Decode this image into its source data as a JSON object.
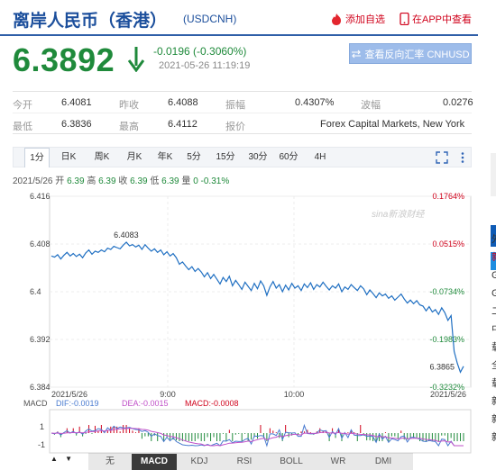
{
  "header": {
    "title": "离岸人民币（香港）",
    "code": "(USDCNH)",
    "add_watch": "添加自选",
    "view_app": "在APP中查看"
  },
  "quote": {
    "price": "6.3892",
    "change": "-0.0196 (-0.3060%)",
    "time": "2021-05-26 11:19:19",
    "reverse_label": "查看反向汇率 CNHUSD",
    "trend": "down",
    "trend_color": "#1f8a3b"
  },
  "stats": {
    "open_label": "今开",
    "open": "6.4081",
    "prev_close_label": "昨收",
    "prev_close": "6.4088",
    "amplitude_label": "振幅",
    "amplitude": "0.4307%",
    "volatility_label": "波幅",
    "volatility": "0.0276",
    "low_label": "最低",
    "low": "6.3836",
    "high_label": "最高",
    "high": "6.4112",
    "quote_label": "报价",
    "quote_source": "Forex Capital Markets, New York"
  },
  "period_tabs": [
    "1分",
    "日K",
    "周K",
    "月K",
    "年K",
    "5分",
    "15分",
    "30分",
    "60分",
    "4H"
  ],
  "active_period": "1分",
  "ohlc_line": {
    "date": "2021/5/26",
    "open_label": "开",
    "open": "6.39",
    "high_label": "高",
    "high": "6.39",
    "close_label": "收",
    "close": "6.39",
    "low_label": "低",
    "low": "6.39",
    "vol_label": "量",
    "vol": "0",
    "pct": "-0.31%"
  },
  "chart_data": {
    "type": "line",
    "y_ticks": [
      "6.416",
      "6.408",
      "6.4",
      "6.392",
      "6.384"
    ],
    "ylim": [
      6.384,
      6.416
    ],
    "pct_ticks": [
      "0.1764%",
      "0.0515%",
      "-0.0734%",
      "-0.1983%",
      "-0.3232%"
    ],
    "x_ticks": [
      "2021/5/26",
      "9:00",
      "10:00",
      "2021/5/26"
    ],
    "max_label": "6.4083",
    "min_label": "6.3865",
    "watermark": "sina新浪财经",
    "series": [
      {
        "values": [
          6.406,
          6.4058,
          6.4062,
          6.4055,
          6.4061,
          6.4066,
          6.406,
          6.4064,
          6.4059,
          6.4063,
          6.4057,
          6.4065,
          6.407,
          6.4063,
          6.4068,
          6.4066,
          6.407,
          6.4067,
          6.4073,
          6.4071,
          6.4076,
          6.4074,
          6.4072,
          6.4078,
          6.4083,
          6.4077,
          6.4079,
          6.4075,
          6.4078,
          6.4071,
          6.4079,
          6.4073,
          6.4068,
          6.4072,
          6.4066,
          6.407,
          6.4062,
          6.4067,
          6.406,
          6.4064,
          6.4057,
          6.4046,
          6.405,
          6.4043,
          6.4037,
          6.4042,
          6.4034,
          6.4039,
          6.4033,
          6.4025,
          6.4032,
          6.4022,
          6.4029,
          6.4021,
          6.4013,
          6.4024,
          6.4017,
          6.4026,
          6.401,
          6.4019,
          6.4012,
          6.4004,
          6.4016,
          6.4009,
          6.4002,
          6.4014,
          6.4005,
          6.4018,
          6.401,
          6.3994,
          6.4008,
          6.4017,
          6.4006,
          6.4012,
          6.4,
          6.4011,
          6.4003,
          6.4014,
          6.4006,
          6.401,
          6.4002,
          6.4013,
          6.4007,
          6.4015,
          6.4004,
          6.4012,
          6.4008,
          6.4016,
          6.4009,
          6.4003,
          6.401,
          6.4006,
          6.4013,
          6.4,
          6.4008,
          6.4004,
          6.4012,
          6.4007,
          6.4002,
          6.401,
          6.4005,
          6.3995,
          6.4003,
          6.3997,
          6.399,
          6.3998,
          6.3993,
          6.3996,
          6.3989,
          6.3993,
          6.3986,
          6.3991,
          6.3996,
          6.3988,
          6.3981,
          6.3986,
          6.398,
          6.3985,
          6.3978,
          6.3976,
          6.3968,
          6.3975,
          6.3966,
          6.397,
          6.3962,
          6.3973,
          6.3965,
          6.3952,
          6.396,
          6.39,
          6.388,
          6.3865,
          6.3875
        ]
      }
    ]
  },
  "macd": {
    "title": "MACD",
    "dif_label": "DIF:",
    "dif": "-0.0019",
    "dea_label": "DEA:",
    "dea": "-0.0015",
    "macd_label": "MACD:",
    "macd": "-0.0008",
    "y_ticks": [
      "1",
      "-1"
    ],
    "colors": {
      "dif": "#4a7bd0",
      "dea": "#c050c8",
      "macd_label": "#d0021b"
    }
  },
  "indicator_tabs": [
    "无",
    "MACD",
    "KDJ",
    "RSI",
    "BOLL",
    "WR",
    "DMI"
  ],
  "active_indicator": "MACD",
  "edge_chars": [
    "外",
    "新",
    "G",
    "G",
    "二",
    "中",
    "载",
    "全",
    "载",
    "新",
    "新",
    "新"
  ]
}
